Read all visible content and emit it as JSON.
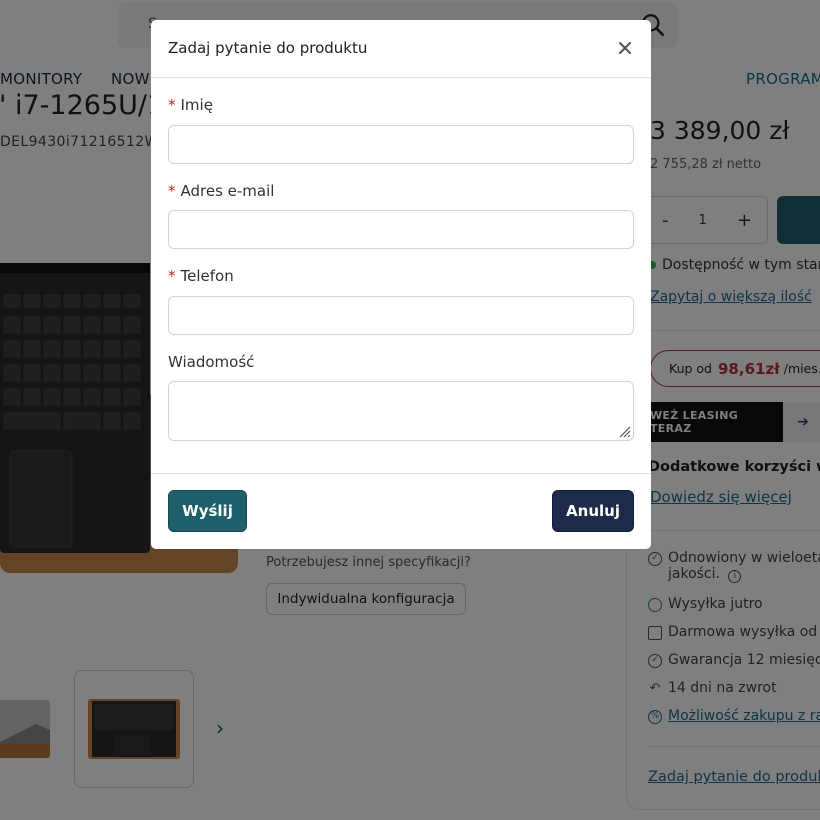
{
  "background": {
    "search": {
      "placeholder_visible": "S"
    },
    "nav": {
      "items": [
        "MONITORY",
        "NOW",
        "PROGRAM"
      ]
    },
    "product": {
      "title_fragment": "\" i7-1265U/16",
      "sku_fragment": "DEL9430i71216512WU",
      "spec_question": "Potrzebujesz innej specyfikacji?",
      "custom_config_label": "Indywidualna konfiguracja"
    },
    "buy_box": {
      "price": "3 389,00 zł",
      "net_price": "2 755,28 zł netto",
      "quantity": "1",
      "qty_minus": "-",
      "qty_plus": "+",
      "availability": "Dostępność w tym stan",
      "ask_more_qty": "Zapytaj o większą ilość",
      "installment_prefix": "Kup od",
      "installment_amount": "98,61zł",
      "installment_suffix": "/mies.",
      "leasing_label": "WEŹ LEASING TERAZ",
      "extra_benefits": "Dodatkowe korzyści w pr",
      "learn_more": "Dowiedz się więcej",
      "features": [
        "Odnowiony w wieloeta",
        "jakości.",
        "Wysyłka jutro",
        "Darmowa wysyłka od 5",
        "Gwarancja 12 miesięcy",
        "14 dni na zwrot",
        "Możliwość zakupu z ra"
      ],
      "ask_product": "Zadaj pytanie do produktu"
    }
  },
  "modal": {
    "title": "Zadaj pytanie do produktu",
    "fields": [
      {
        "label": "Imię",
        "required": true,
        "value": ""
      },
      {
        "label": "Adres e-mail",
        "required": true,
        "value": ""
      },
      {
        "label": "Telefon",
        "required": true,
        "value": ""
      },
      {
        "label": "Wiadomość",
        "required": false,
        "value": ""
      }
    ],
    "required_marker": "*",
    "submit_label": "Wyślij",
    "cancel_label": "Anuluj"
  },
  "colors": {
    "primary_teal": "#1f5f6b",
    "cancel_navy": "#1e2a4a",
    "link": "#1d6a8c",
    "installment_red": "#b53040",
    "required_red": "#cc2222"
  }
}
